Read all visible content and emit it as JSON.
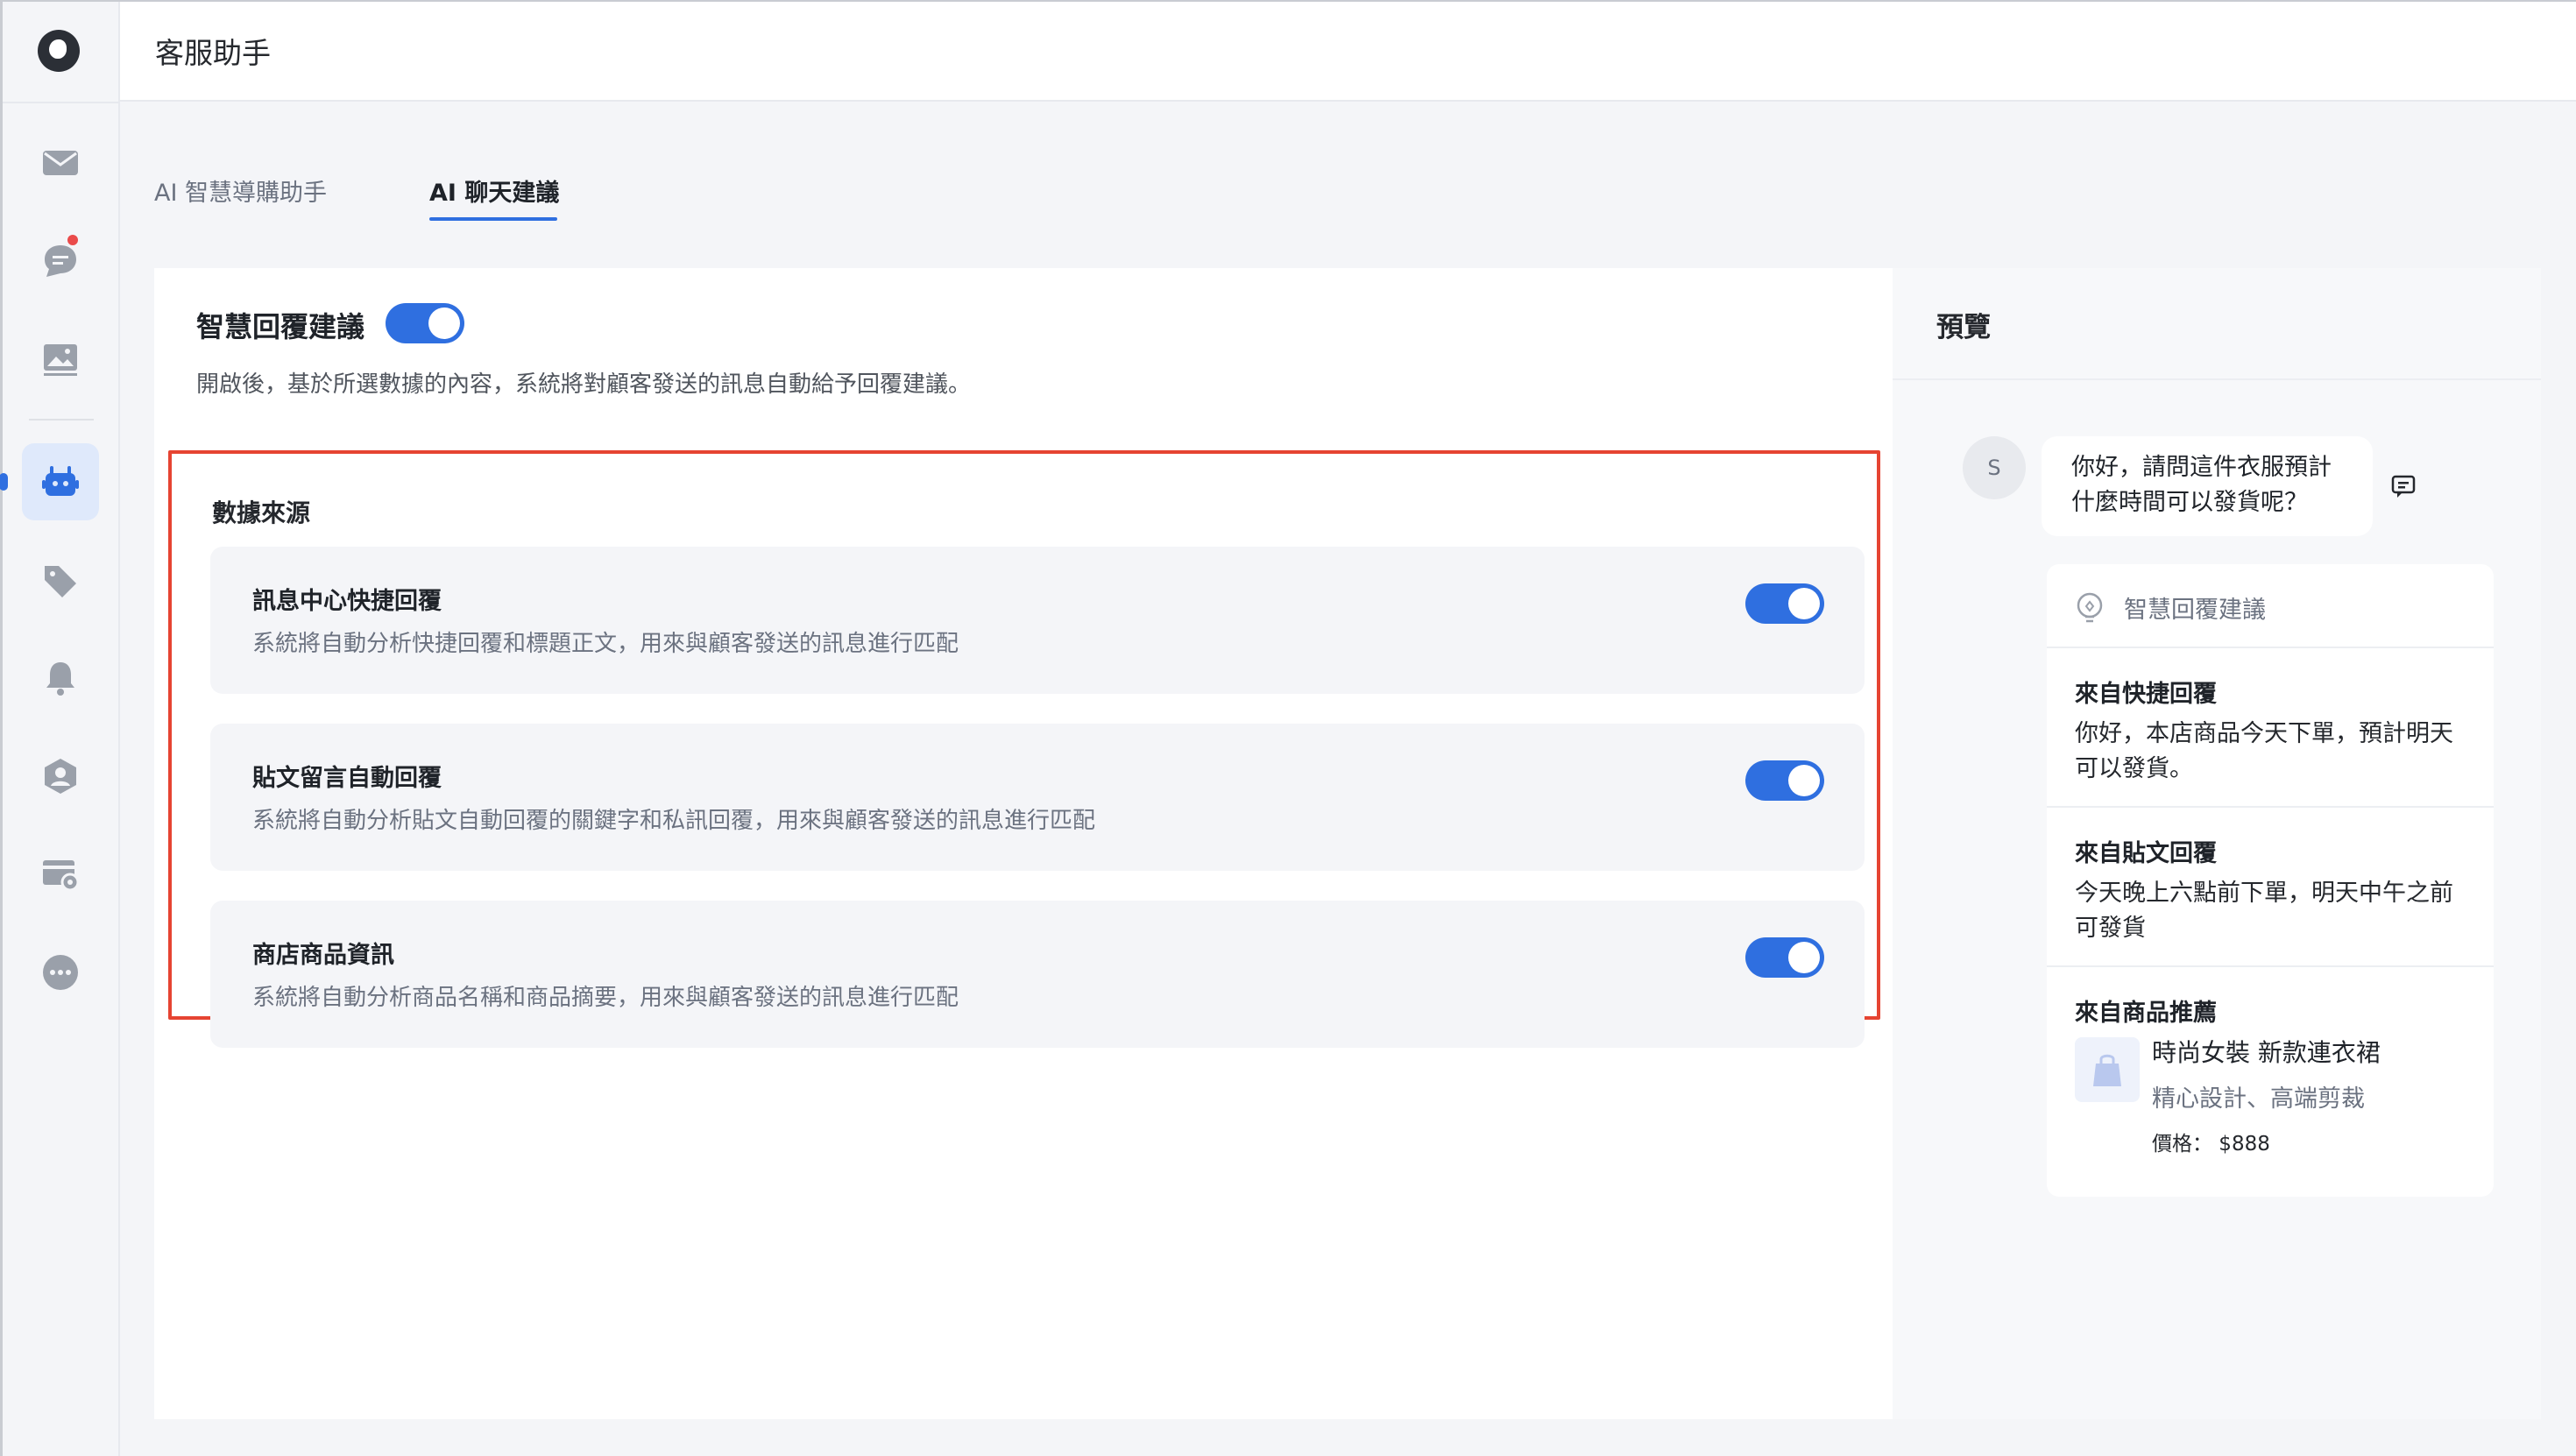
{
  "header": {
    "title": "客服助手"
  },
  "sidebar": {
    "items": [
      {
        "name": "inbox",
        "icon": "mail-icon"
      },
      {
        "name": "chat",
        "icon": "chat-bubble-icon",
        "badge": true
      },
      {
        "name": "media",
        "icon": "image-icon"
      },
      {
        "name": "ai-assistant",
        "icon": "robot-icon",
        "active": true
      },
      {
        "name": "tags",
        "icon": "tag-icon"
      },
      {
        "name": "notifications",
        "icon": "bell-icon"
      },
      {
        "name": "contacts",
        "icon": "user-shield-icon"
      },
      {
        "name": "settings-card",
        "icon": "card-gear-icon"
      },
      {
        "name": "more",
        "icon": "more-icon"
      }
    ]
  },
  "tabs": [
    {
      "label": "AI 智慧導購助手",
      "active": false
    },
    {
      "label": "AI 聊天建議",
      "active": true
    }
  ],
  "smart_reply": {
    "title": "智慧回覆建議",
    "enabled": true,
    "description": "開啟後，基於所選數據的內容，系統將對顧客發送的訊息自動給予回覆建議。"
  },
  "data_source": {
    "title": "數據來源",
    "items": [
      {
        "name": "訊息中心快捷回覆",
        "desc": "系統將自動分析快捷回覆和標題正文，用來與顧客發送的訊息進行匹配",
        "enabled": true
      },
      {
        "name": "貼文留言自動回覆",
        "desc": "系統將自動分析貼文自動回覆的關鍵字和私訊回覆，用來與顧客發送的訊息進行匹配",
        "enabled": true
      },
      {
        "name": "商店商品資訊",
        "desc": "系統將自動分析商品名稱和商品摘要，用來與顧客發送的訊息進行匹配",
        "enabled": true
      }
    ]
  },
  "preview": {
    "title": "預覽",
    "avatar_letter": "S",
    "customer_message": "你好，請問這件衣服預計什麼時間可以發貨呢？",
    "suggest_label": "智慧回覆建議",
    "quick_reply": {
      "heading": "來自快捷回覆",
      "body": "你好，本店商品今天下單，預計明天可以發貨。"
    },
    "post_reply": {
      "heading": "來自貼文回覆",
      "body": "今天晚上六點前下單，明天中午之前可發貨"
    },
    "product": {
      "heading": "來自商品推薦",
      "name": "時尚女裝 新款連衣裙",
      "summary": "精心設計、高端剪裁",
      "price": "價格：  $888"
    }
  },
  "colors": {
    "accent": "#2f6fe0",
    "highlight_border": "#e64432",
    "badge": "#ea4b4b"
  }
}
